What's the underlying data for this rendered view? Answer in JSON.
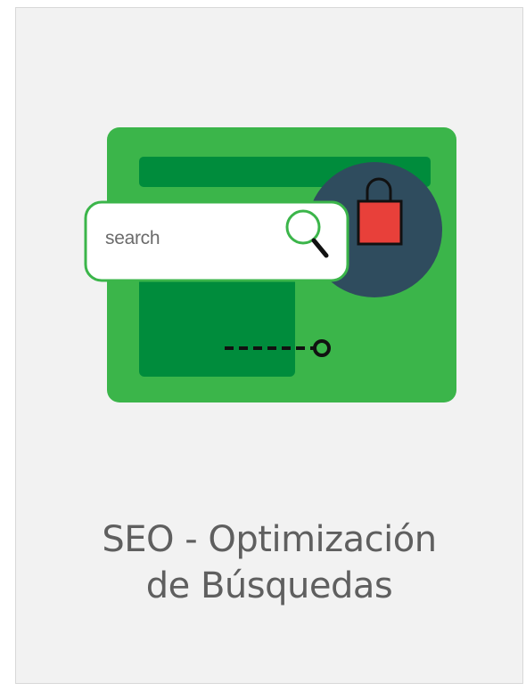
{
  "illustration": {
    "search_placeholder": "search",
    "colors": {
      "browser_bg": "#3bb54a",
      "browser_dark": "#008c3c",
      "circle": "#2f4c5e",
      "bag": "#e8403a",
      "search_border": "#3bb54a",
      "icon_green": "#3bb54a"
    }
  },
  "title": {
    "line1": "SEO - Optimización",
    "line2": "de Búsquedas"
  }
}
